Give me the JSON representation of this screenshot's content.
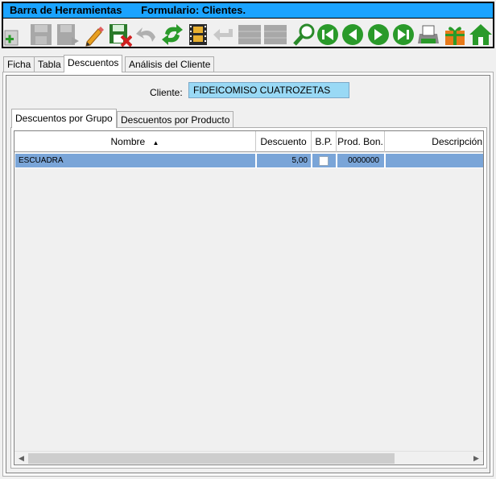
{
  "toolbar": {
    "title": "Barra de Herramientas",
    "form_title": "Formulario: Clientes.",
    "icons": [
      "add-icon",
      "save-disabled-icon",
      "save-as-disabled-icon",
      "edit-icon",
      "save-delete-icon",
      "undo-disabled-icon",
      "refresh-icon",
      "film-icon",
      "back-disabled-icon",
      "grid-disabled-icon",
      "grid2-disabled-icon",
      "search-icon",
      "first-icon",
      "previous-icon",
      "next-icon",
      "last-icon",
      "print-icon",
      "gift-icon",
      "home-icon"
    ]
  },
  "tabs": [
    "Ficha",
    "Tabla",
    "Descuentos",
    "Análisis del Cliente"
  ],
  "client": {
    "label": "Cliente:",
    "value": "FIDEICOMISO CUATROZETAS"
  },
  "subtabs": [
    "Descuentos por Grupo",
    "Descuentos por Producto"
  ],
  "grid": {
    "columns": [
      "Nombre",
      "Descuento",
      "B.P.",
      "Prod. Bon.",
      "Descripción"
    ],
    "sort_indicator": "▲",
    "rows": [
      {
        "nombre": "ESCUADRA",
        "descuento": "5,00",
        "bp": false,
        "prod_bon": "0000000",
        "descripcion": ""
      }
    ]
  },
  "colors": {
    "title_bar": "#1aa3ff",
    "selected_row": "#7aa5d8",
    "client_field": "#99d9f5"
  }
}
